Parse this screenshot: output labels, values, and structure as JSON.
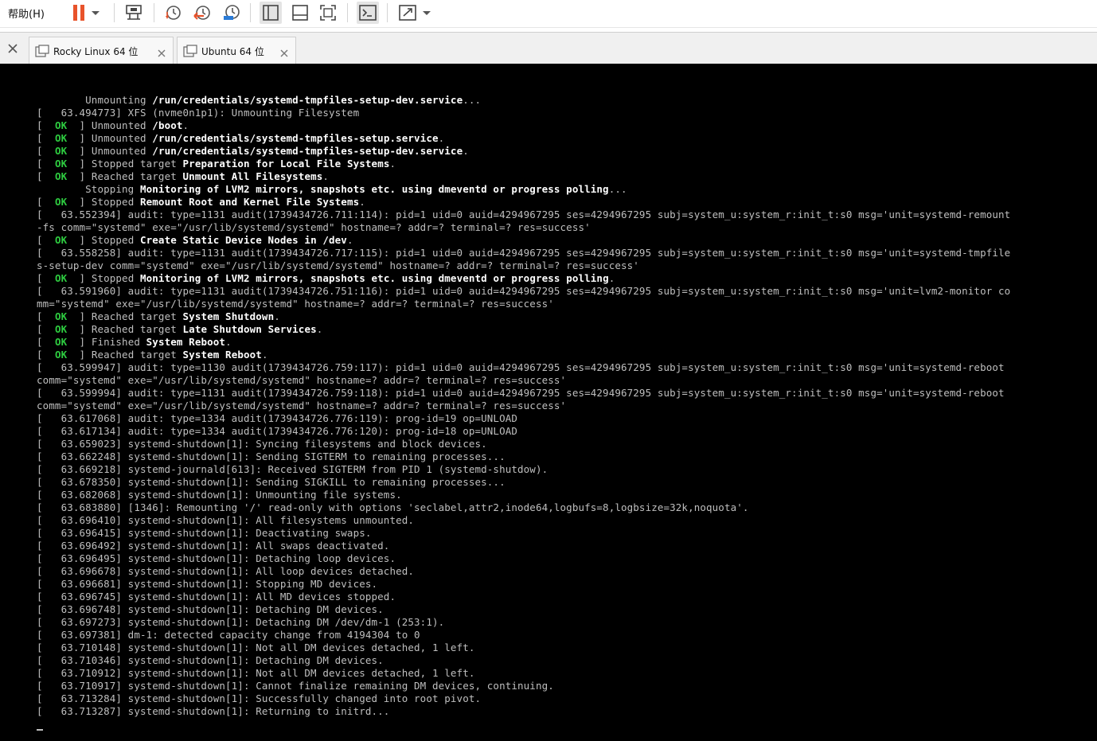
{
  "toolbar": {
    "help_menu": "帮助(H)",
    "icons": [
      "pause-icon",
      "dropdown-arrow-icon",
      "send-keys-icon",
      "snapshot-icon",
      "revert-snapshot-icon",
      "snapshot-manager-icon",
      "library-icon",
      "hide-tabs-icon",
      "fullscreen-icon",
      "console-view-icon",
      "stretch-icon",
      "stretch-dropdown-icon"
    ],
    "accent": "#e8532b"
  },
  "tabs": [
    {
      "label": "Rocky Linux 64 位"
    },
    {
      "label": "Ubuntu 64 位"
    }
  ],
  "console": {
    "lines": [
      {
        "pre": "        Unmounting ",
        "hl": "/run/credentials/systemd-tmpfiles-setup-dev.service",
        "post": "..."
      },
      {
        "pre": "[   63.494773] XFS (nvme0n1p1): Unmounting Filesystem"
      },
      {
        "ok": true,
        "pre": " Unmounted ",
        "hl": "/boot",
        "post": "."
      },
      {
        "ok": true,
        "pre": " Unmounted ",
        "hl": "/run/credentials/systemd-tmpfiles-setup.service",
        "post": "."
      },
      {
        "ok": true,
        "pre": " Unmounted ",
        "hl": "/run/credentials/systemd-tmpfiles-setup-dev.service",
        "post": "."
      },
      {
        "ok": true,
        "pre": " Stopped target ",
        "hl": "Preparation for Local File Systems",
        "post": "."
      },
      {
        "ok": true,
        "pre": " Reached target ",
        "hl": "Unmount All Filesystems",
        "post": "."
      },
      {
        "pre": "        Stopping ",
        "hl": "Monitoring of LVM2 mirrors, snapshots etc. using dmeventd or progress polling",
        "post": "..."
      },
      {
        "ok": true,
        "pre": " Stopped ",
        "hl": "Remount Root and Kernel File Systems",
        "post": "."
      },
      {
        "pre": "[   63.552394] audit: type=1131 audit(1739434726.711:114): pid=1 uid=0 auid=4294967295 ses=4294967295 subj=system_u:system_r:init_t:s0 msg='unit=systemd-remount"
      },
      {
        "pre": "-fs comm=\"systemd\" exe=\"/usr/lib/systemd/systemd\" hostname=? addr=? terminal=? res=success'"
      },
      {
        "ok": true,
        "pre": " Stopped ",
        "hl": "Create Static Device Nodes in /dev",
        "post": "."
      },
      {
        "pre": "[   63.558258] audit: type=1131 audit(1739434726.717:115): pid=1 uid=0 auid=4294967295 ses=4294967295 subj=system_u:system_r:init_t:s0 msg='unit=systemd-tmpfile"
      },
      {
        "pre": "s-setup-dev comm=\"systemd\" exe=\"/usr/lib/systemd/systemd\" hostname=? addr=? terminal=? res=success'"
      },
      {
        "ok": true,
        "pre": " Stopped ",
        "hl": "Monitoring of LVM2 mirrors, snapshots etc. using dmeventd or progress polling",
        "post": "."
      },
      {
        "pre": "[   63.591960] audit: type=1131 audit(1739434726.751:116): pid=1 uid=0 auid=4294967295 ses=4294967295 subj=system_u:system_r:init_t:s0 msg='unit=lvm2-monitor co"
      },
      {
        "pre": "mm=\"systemd\" exe=\"/usr/lib/systemd/systemd\" hostname=? addr=? terminal=? res=success'"
      },
      {
        "ok": true,
        "pre": " Reached target ",
        "hl": "System Shutdown",
        "post": "."
      },
      {
        "ok": true,
        "pre": " Reached target ",
        "hl": "Late Shutdown Services",
        "post": "."
      },
      {
        "ok": true,
        "pre": " Finished ",
        "hl": "System Reboot",
        "post": "."
      },
      {
        "ok": true,
        "pre": " Reached target ",
        "hl": "System Reboot",
        "post": "."
      },
      {
        "pre": "[   63.599947] audit: type=1130 audit(1739434726.759:117): pid=1 uid=0 auid=4294967295 ses=4294967295 subj=system_u:system_r:init_t:s0 msg='unit=systemd-reboot"
      },
      {
        "pre": "comm=\"systemd\" exe=\"/usr/lib/systemd/systemd\" hostname=? addr=? terminal=? res=success'"
      },
      {
        "pre": "[   63.599994] audit: type=1131 audit(1739434726.759:118): pid=1 uid=0 auid=4294967295 ses=4294967295 subj=system_u:system_r:init_t:s0 msg='unit=systemd-reboot"
      },
      {
        "pre": "comm=\"systemd\" exe=\"/usr/lib/systemd/systemd\" hostname=? addr=? terminal=? res=success'"
      },
      {
        "pre": "[   63.617068] audit: type=1334 audit(1739434726.776:119): prog-id=19 op=UNLOAD"
      },
      {
        "pre": "[   63.617134] audit: type=1334 audit(1739434726.776:120): prog-id=18 op=UNLOAD"
      },
      {
        "pre": "[   63.659023] systemd-shutdown[1]: Syncing filesystems and block devices."
      },
      {
        "pre": "[   63.662248] systemd-shutdown[1]: Sending SIGTERM to remaining processes..."
      },
      {
        "pre": "[   63.669218] systemd-journald[613]: Received SIGTERM from PID 1 (systemd-shutdow)."
      },
      {
        "pre": "[   63.678350] systemd-shutdown[1]: Sending SIGKILL to remaining processes..."
      },
      {
        "pre": "[   63.682068] systemd-shutdown[1]: Unmounting file systems."
      },
      {
        "pre": "[   63.683880] [1346]: Remounting '/' read-only with options 'seclabel,attr2,inode64,logbufs=8,logbsize=32k,noquota'."
      },
      {
        "pre": "[   63.696410] systemd-shutdown[1]: All filesystems unmounted."
      },
      {
        "pre": "[   63.696415] systemd-shutdown[1]: Deactivating swaps."
      },
      {
        "pre": "[   63.696492] systemd-shutdown[1]: All swaps deactivated."
      },
      {
        "pre": "[   63.696495] systemd-shutdown[1]: Detaching loop devices."
      },
      {
        "pre": "[   63.696678] systemd-shutdown[1]: All loop devices detached."
      },
      {
        "pre": "[   63.696681] systemd-shutdown[1]: Stopping MD devices."
      },
      {
        "pre": "[   63.696745] systemd-shutdown[1]: All MD devices stopped."
      },
      {
        "pre": "[   63.696748] systemd-shutdown[1]: Detaching DM devices."
      },
      {
        "pre": "[   63.697273] systemd-shutdown[1]: Detaching DM /dev/dm-1 (253:1)."
      },
      {
        "pre": "[   63.697381] dm-1: detected capacity change from 4194304 to 0"
      },
      {
        "pre": "[   63.710148] systemd-shutdown[1]: Not all DM devices detached, 1 left."
      },
      {
        "pre": "[   63.710346] systemd-shutdown[1]: Detaching DM devices."
      },
      {
        "pre": "[   63.710912] systemd-shutdown[1]: Not all DM devices detached, 1 left."
      },
      {
        "pre": "[   63.710917] systemd-shutdown[1]: Cannot finalize remaining DM devices, continuing."
      },
      {
        "pre": "[   63.713284] systemd-shutdown[1]: Successfully changed into root pivot."
      },
      {
        "pre": "[   63.713287] systemd-shutdown[1]: Returning to initrd..."
      }
    ],
    "ok_label": "  OK  ",
    "cursor": "_"
  }
}
